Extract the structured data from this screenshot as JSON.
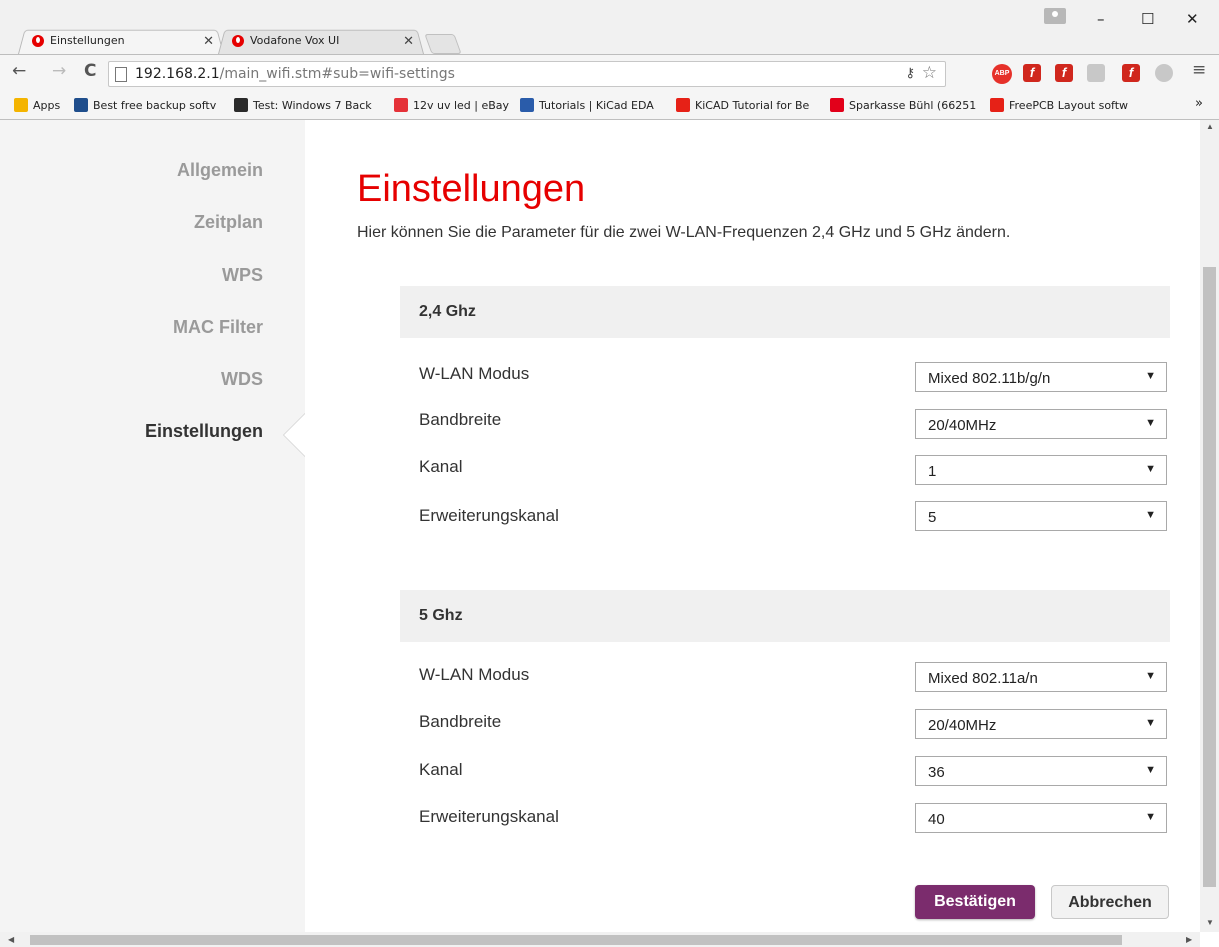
{
  "tabs": [
    {
      "title": "Einstellungen",
      "active": true
    },
    {
      "title": "Vodafone Vox UI",
      "active": false
    }
  ],
  "window": {
    "minimize": "–",
    "maximize": "☐",
    "close": "✕"
  },
  "address_bar": {
    "host": "192.168.2.1",
    "path": "/main_wifi.stm#sub=wifi-settings"
  },
  "extensions": [
    {
      "label": "ABP",
      "color": "#e6312a"
    },
    {
      "label": "f",
      "color": "#d0271d"
    },
    {
      "label": "f",
      "color": "#d0271d"
    },
    {
      "label": "",
      "color": "#c8c8c8"
    },
    {
      "label": "f",
      "color": "#d0271d"
    },
    {
      "label": "",
      "color": "#c8c8c8"
    }
  ],
  "bookmarks": [
    {
      "label": "Apps",
      "icon_color": "#f4b400"
    },
    {
      "label": "Best free backup softv",
      "icon_color": "#1f4e8c"
    },
    {
      "label": "Test: Windows 7 Back",
      "icon_color": "#2b2b2b"
    },
    {
      "label": "12v uv led | eBay",
      "icon_color": "#e53238"
    },
    {
      "label": "Tutorials | KiCad EDA",
      "icon_color": "#2a5caa"
    },
    {
      "label": "KiCAD Tutorial for Be",
      "icon_color": "#e62117"
    },
    {
      "label": "Sparkasse Bühl (66251",
      "icon_color": "#e2001a"
    },
    {
      "label": "FreePCB Layout softw",
      "icon_color": "#e62117"
    }
  ],
  "sidebar": {
    "items": [
      {
        "label": "Allgemein"
      },
      {
        "label": "Zeitplan"
      },
      {
        "label": "WPS"
      },
      {
        "label": "MAC Filter"
      },
      {
        "label": "WDS"
      },
      {
        "label": "Einstellungen",
        "active": true
      }
    ]
  },
  "main": {
    "title": "Einstellungen",
    "description": "Hier können Sie die Parameter für die zwei W-LAN-Frequenzen 2,4 GHz und 5 GHz ändern.",
    "sections": [
      {
        "header": "2,4 Ghz",
        "rows": [
          {
            "label": "W-LAN Modus",
            "value": "Mixed 802.11b/g/n"
          },
          {
            "label": "Bandbreite",
            "value": "20/40MHz"
          },
          {
            "label": "Kanal",
            "value": "1"
          },
          {
            "label": "Erweiterungskanal",
            "value": "5"
          }
        ]
      },
      {
        "header": "5 Ghz",
        "rows": [
          {
            "label": "W-LAN Modus",
            "value": "Mixed 802.11a/n"
          },
          {
            "label": "Bandbreite",
            "value": "20/40MHz"
          },
          {
            "label": "Kanal",
            "value": "36"
          },
          {
            "label": "Erweiterungskanal",
            "value": "40"
          }
        ]
      }
    ],
    "confirm_label": "Bestätigen",
    "cancel_label": "Abbrechen"
  },
  "colors": {
    "brand": "#e60000",
    "primary_button": "#7b2c6d"
  }
}
